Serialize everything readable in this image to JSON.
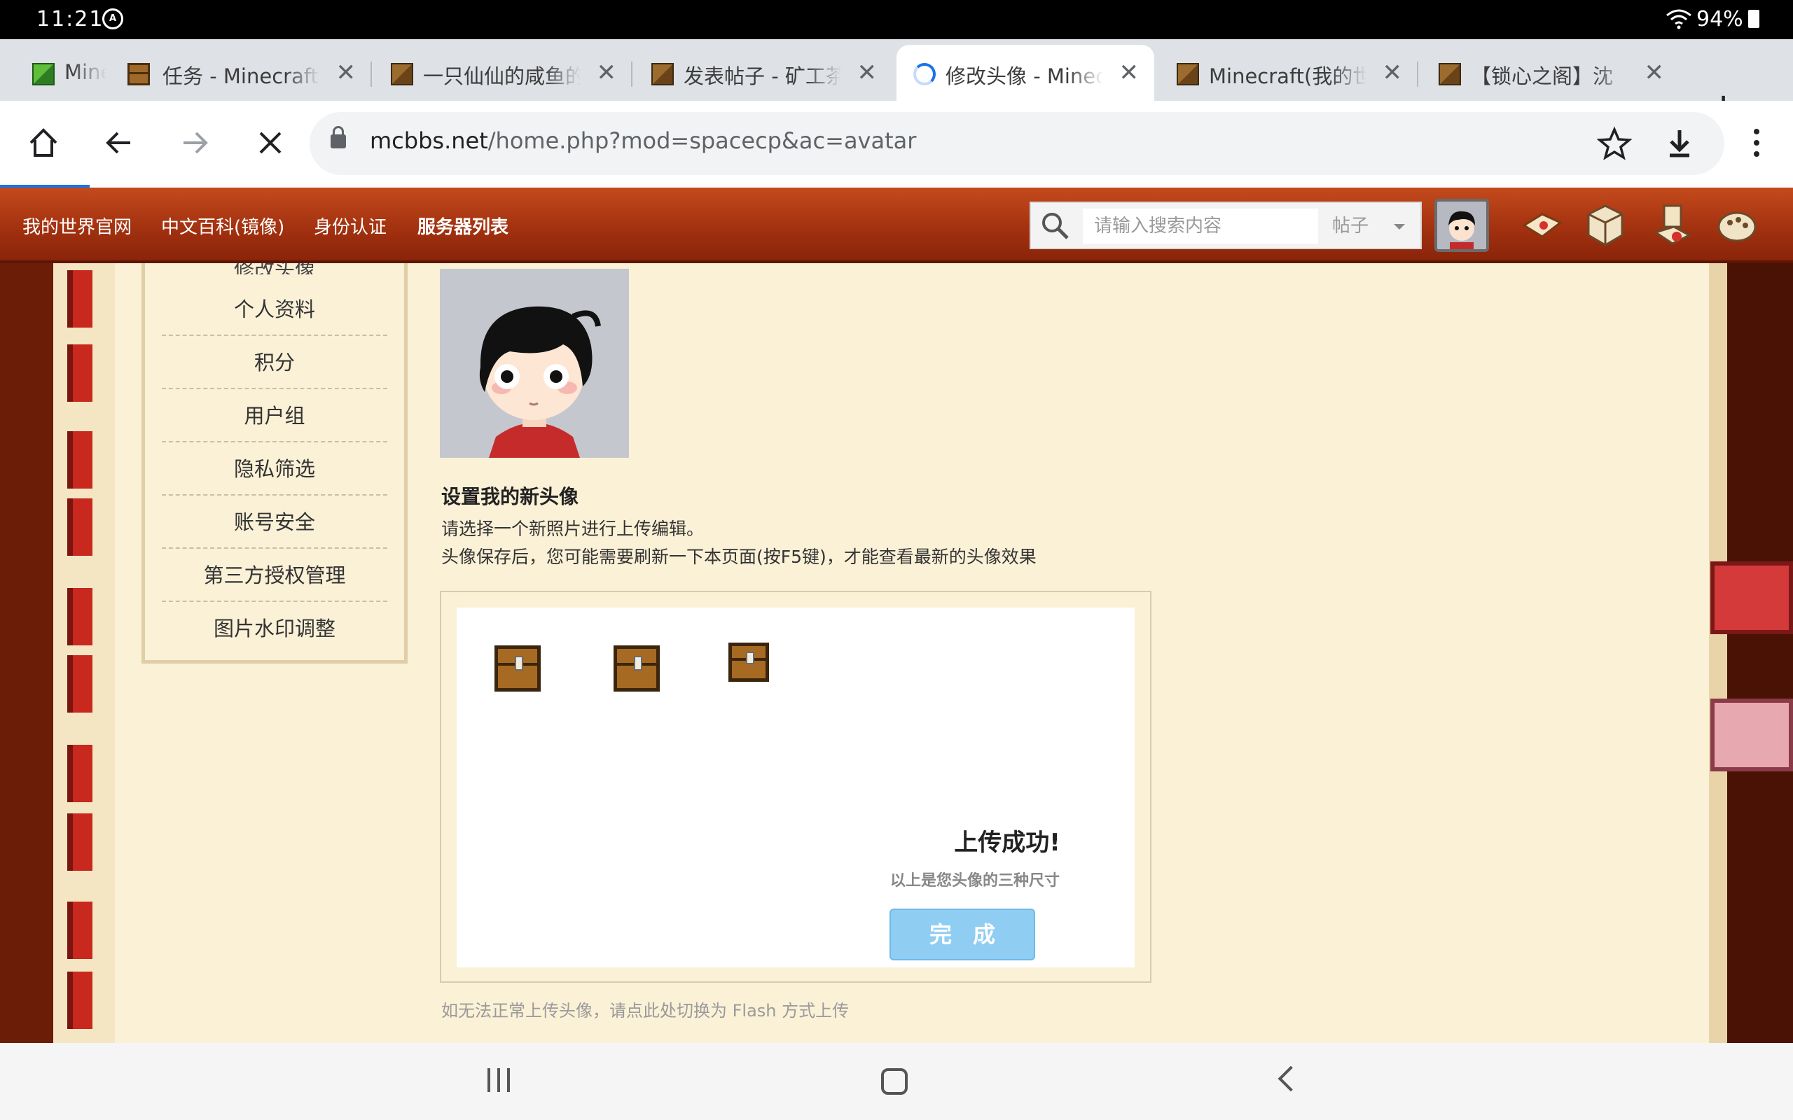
{
  "status_bar": {
    "time": "11:21",
    "battery": "94%"
  },
  "tabs": [
    {
      "title": "Mine",
      "favicon": "green-cube-icon",
      "active": false
    },
    {
      "title": "任务 - Minecraft(我的世界)中文论坛",
      "favicon": "chest-icon",
      "active": false
    },
    {
      "title": "一只仙仙的咸鱼的空间",
      "favicon": "cube-icon",
      "active": false
    },
    {
      "title": "发表帖子 - 矿工茶馆",
      "favicon": "cube-icon",
      "active": false
    },
    {
      "title": "修改头像 - Minecraft",
      "favicon": "loading-spinner-icon",
      "active": true
    },
    {
      "title": "Minecraft(我的世界)",
      "favicon": "cube-icon",
      "active": false
    },
    {
      "title": "【锁心之阁】沈",
      "favicon": "cube-icon",
      "active": false
    }
  ],
  "address_bar": {
    "host": "mcbbs.net",
    "path": "/home.php?mod=spacecp&ac=avatar"
  },
  "site_nav": {
    "links": [
      "我的世界官网",
      "中文百科(镜像)",
      "身份认证",
      "服务器列表"
    ],
    "search_placeholder": "请输入搜索内容",
    "search_scope": "帖子"
  },
  "sidebar": {
    "cut_item": "修改头像",
    "items": [
      "个人资料",
      "积分",
      "用户组",
      "隐私筛选",
      "账号安全",
      "第三方授权管理",
      "图片水印调整"
    ]
  },
  "avatar_section": {
    "title": "设置我的新头像",
    "instruction": "请选择一个新照片进行上传编辑。",
    "note": "头像保存后，您可能需要刷新一下本页面(按F5键)，才能查看最新的头像效果",
    "success_title": "上传成功!",
    "success_sub": "以上是您头像的三种尺寸",
    "done_button": "完成",
    "flash_link": "如无法正常上传头像，请点此处切换为 Flash 方式上传"
  },
  "colors": {
    "nav_red": "#a0300f",
    "content_bg": "#fbf1d7",
    "done_button": "#8fcdf3",
    "chrome_blue": "#1a73e8"
  }
}
